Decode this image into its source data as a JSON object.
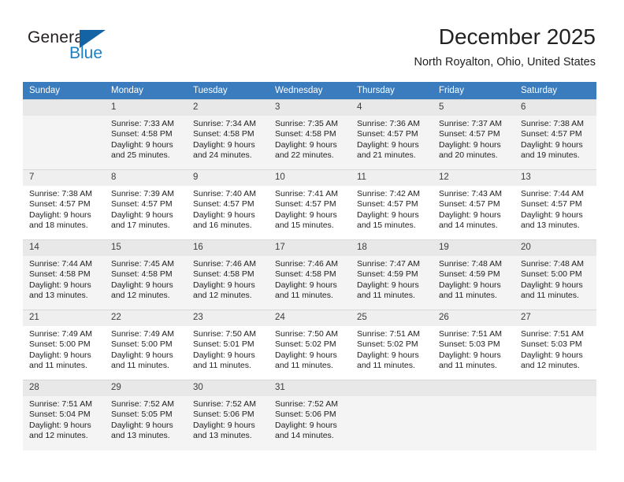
{
  "brand": {
    "name_part1": "General",
    "name_part2": "Blue",
    "logo_icon": "triangle-flag-icon"
  },
  "header": {
    "title": "December 2025",
    "subtitle": "North Royalton, Ohio, United States"
  },
  "calendar": {
    "weekday_headers": [
      "Sunday",
      "Monday",
      "Tuesday",
      "Wednesday",
      "Thursday",
      "Friday",
      "Saturday"
    ],
    "accent_color": "#3a7cbe",
    "weeks": [
      [
        {
          "day": "",
          "sunrise": "",
          "sunset": "",
          "daylight_line1": "",
          "daylight_line2": ""
        },
        {
          "day": "1",
          "sunrise": "Sunrise: 7:33 AM",
          "sunset": "Sunset: 4:58 PM",
          "daylight_line1": "Daylight: 9 hours",
          "daylight_line2": "and 25 minutes."
        },
        {
          "day": "2",
          "sunrise": "Sunrise: 7:34 AM",
          "sunset": "Sunset: 4:58 PM",
          "daylight_line1": "Daylight: 9 hours",
          "daylight_line2": "and 24 minutes."
        },
        {
          "day": "3",
          "sunrise": "Sunrise: 7:35 AM",
          "sunset": "Sunset: 4:58 PM",
          "daylight_line1": "Daylight: 9 hours",
          "daylight_line2": "and 22 minutes."
        },
        {
          "day": "4",
          "sunrise": "Sunrise: 7:36 AM",
          "sunset": "Sunset: 4:57 PM",
          "daylight_line1": "Daylight: 9 hours",
          "daylight_line2": "and 21 minutes."
        },
        {
          "day": "5",
          "sunrise": "Sunrise: 7:37 AM",
          "sunset": "Sunset: 4:57 PM",
          "daylight_line1": "Daylight: 9 hours",
          "daylight_line2": "and 20 minutes."
        },
        {
          "day": "6",
          "sunrise": "Sunrise: 7:38 AM",
          "sunset": "Sunset: 4:57 PM",
          "daylight_line1": "Daylight: 9 hours",
          "daylight_line2": "and 19 minutes."
        }
      ],
      [
        {
          "day": "7",
          "sunrise": "Sunrise: 7:38 AM",
          "sunset": "Sunset: 4:57 PM",
          "daylight_line1": "Daylight: 9 hours",
          "daylight_line2": "and 18 minutes."
        },
        {
          "day": "8",
          "sunrise": "Sunrise: 7:39 AM",
          "sunset": "Sunset: 4:57 PM",
          "daylight_line1": "Daylight: 9 hours",
          "daylight_line2": "and 17 minutes."
        },
        {
          "day": "9",
          "sunrise": "Sunrise: 7:40 AM",
          "sunset": "Sunset: 4:57 PM",
          "daylight_line1": "Daylight: 9 hours",
          "daylight_line2": "and 16 minutes."
        },
        {
          "day": "10",
          "sunrise": "Sunrise: 7:41 AM",
          "sunset": "Sunset: 4:57 PM",
          "daylight_line1": "Daylight: 9 hours",
          "daylight_line2": "and 15 minutes."
        },
        {
          "day": "11",
          "sunrise": "Sunrise: 7:42 AM",
          "sunset": "Sunset: 4:57 PM",
          "daylight_line1": "Daylight: 9 hours",
          "daylight_line2": "and 15 minutes."
        },
        {
          "day": "12",
          "sunrise": "Sunrise: 7:43 AM",
          "sunset": "Sunset: 4:57 PM",
          "daylight_line1": "Daylight: 9 hours",
          "daylight_line2": "and 14 minutes."
        },
        {
          "day": "13",
          "sunrise": "Sunrise: 7:44 AM",
          "sunset": "Sunset: 4:57 PM",
          "daylight_line1": "Daylight: 9 hours",
          "daylight_line2": "and 13 minutes."
        }
      ],
      [
        {
          "day": "14",
          "sunrise": "Sunrise: 7:44 AM",
          "sunset": "Sunset: 4:58 PM",
          "daylight_line1": "Daylight: 9 hours",
          "daylight_line2": "and 13 minutes."
        },
        {
          "day": "15",
          "sunrise": "Sunrise: 7:45 AM",
          "sunset": "Sunset: 4:58 PM",
          "daylight_line1": "Daylight: 9 hours",
          "daylight_line2": "and 12 minutes."
        },
        {
          "day": "16",
          "sunrise": "Sunrise: 7:46 AM",
          "sunset": "Sunset: 4:58 PM",
          "daylight_line1": "Daylight: 9 hours",
          "daylight_line2": "and 12 minutes."
        },
        {
          "day": "17",
          "sunrise": "Sunrise: 7:46 AM",
          "sunset": "Sunset: 4:58 PM",
          "daylight_line1": "Daylight: 9 hours",
          "daylight_line2": "and 11 minutes."
        },
        {
          "day": "18",
          "sunrise": "Sunrise: 7:47 AM",
          "sunset": "Sunset: 4:59 PM",
          "daylight_line1": "Daylight: 9 hours",
          "daylight_line2": "and 11 minutes."
        },
        {
          "day": "19",
          "sunrise": "Sunrise: 7:48 AM",
          "sunset": "Sunset: 4:59 PM",
          "daylight_line1": "Daylight: 9 hours",
          "daylight_line2": "and 11 minutes."
        },
        {
          "day": "20",
          "sunrise": "Sunrise: 7:48 AM",
          "sunset": "Sunset: 5:00 PM",
          "daylight_line1": "Daylight: 9 hours",
          "daylight_line2": "and 11 minutes."
        }
      ],
      [
        {
          "day": "21",
          "sunrise": "Sunrise: 7:49 AM",
          "sunset": "Sunset: 5:00 PM",
          "daylight_line1": "Daylight: 9 hours",
          "daylight_line2": "and 11 minutes."
        },
        {
          "day": "22",
          "sunrise": "Sunrise: 7:49 AM",
          "sunset": "Sunset: 5:00 PM",
          "daylight_line1": "Daylight: 9 hours",
          "daylight_line2": "and 11 minutes."
        },
        {
          "day": "23",
          "sunrise": "Sunrise: 7:50 AM",
          "sunset": "Sunset: 5:01 PM",
          "daylight_line1": "Daylight: 9 hours",
          "daylight_line2": "and 11 minutes."
        },
        {
          "day": "24",
          "sunrise": "Sunrise: 7:50 AM",
          "sunset": "Sunset: 5:02 PM",
          "daylight_line1": "Daylight: 9 hours",
          "daylight_line2": "and 11 minutes."
        },
        {
          "day": "25",
          "sunrise": "Sunrise: 7:51 AM",
          "sunset": "Sunset: 5:02 PM",
          "daylight_line1": "Daylight: 9 hours",
          "daylight_line2": "and 11 minutes."
        },
        {
          "day": "26",
          "sunrise": "Sunrise: 7:51 AM",
          "sunset": "Sunset: 5:03 PM",
          "daylight_line1": "Daylight: 9 hours",
          "daylight_line2": "and 11 minutes."
        },
        {
          "day": "27",
          "sunrise": "Sunrise: 7:51 AM",
          "sunset": "Sunset: 5:03 PM",
          "daylight_line1": "Daylight: 9 hours",
          "daylight_line2": "and 12 minutes."
        }
      ],
      [
        {
          "day": "28",
          "sunrise": "Sunrise: 7:51 AM",
          "sunset": "Sunset: 5:04 PM",
          "daylight_line1": "Daylight: 9 hours",
          "daylight_line2": "and 12 minutes."
        },
        {
          "day": "29",
          "sunrise": "Sunrise: 7:52 AM",
          "sunset": "Sunset: 5:05 PM",
          "daylight_line1": "Daylight: 9 hours",
          "daylight_line2": "and 13 minutes."
        },
        {
          "day": "30",
          "sunrise": "Sunrise: 7:52 AM",
          "sunset": "Sunset: 5:06 PM",
          "daylight_line1": "Daylight: 9 hours",
          "daylight_line2": "and 13 minutes."
        },
        {
          "day": "31",
          "sunrise": "Sunrise: 7:52 AM",
          "sunset": "Sunset: 5:06 PM",
          "daylight_line1": "Daylight: 9 hours",
          "daylight_line2": "and 14 minutes."
        },
        {
          "day": "",
          "sunrise": "",
          "sunset": "",
          "daylight_line1": "",
          "daylight_line2": ""
        },
        {
          "day": "",
          "sunrise": "",
          "sunset": "",
          "daylight_line1": "",
          "daylight_line2": ""
        },
        {
          "day": "",
          "sunrise": "",
          "sunset": "",
          "daylight_line1": "",
          "daylight_line2": ""
        }
      ]
    ]
  }
}
